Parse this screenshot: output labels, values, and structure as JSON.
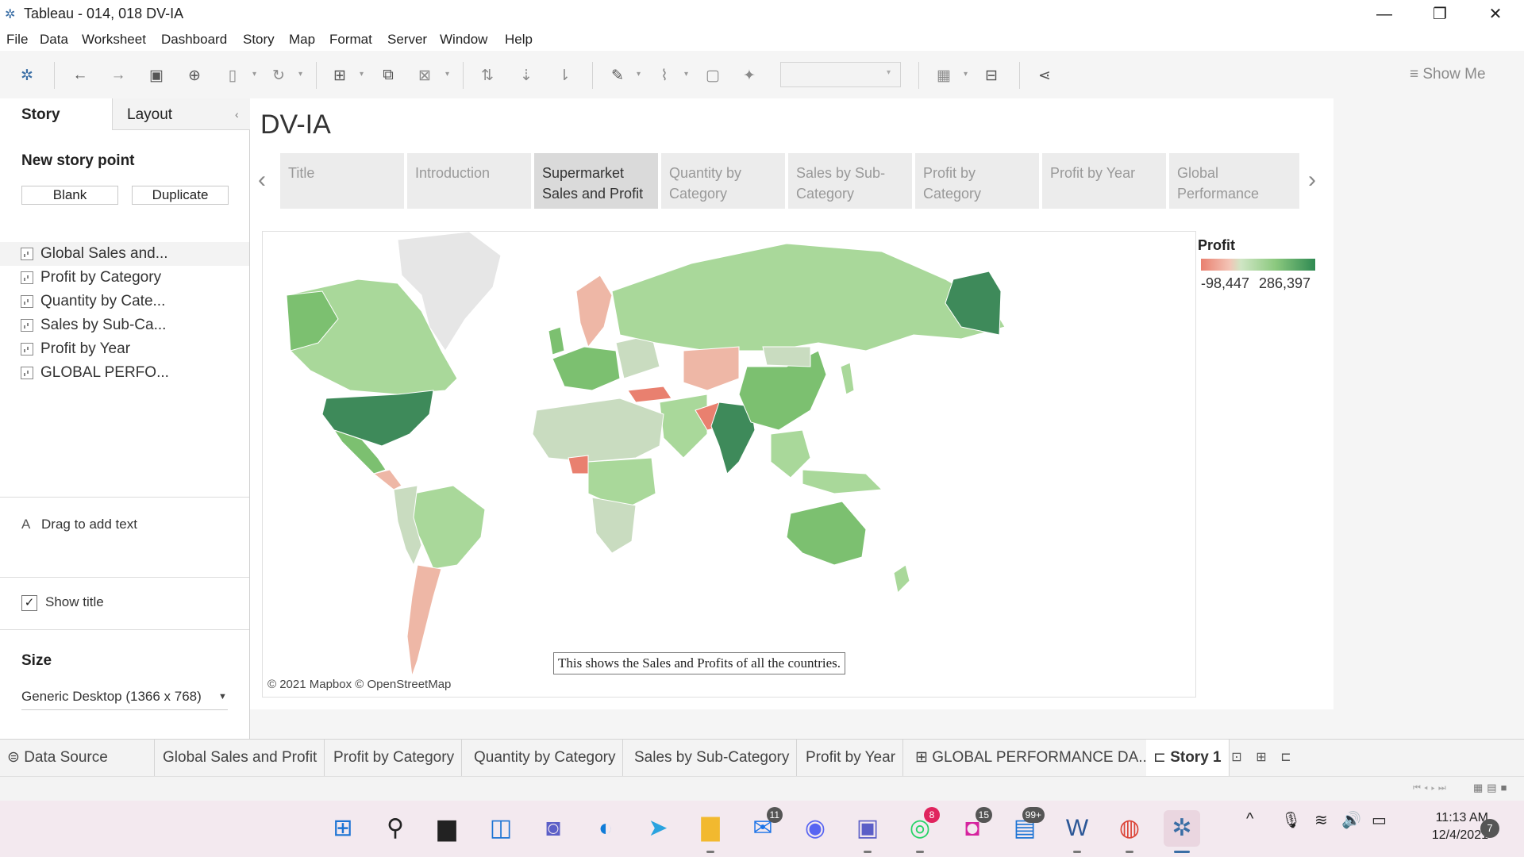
{
  "window": {
    "title": "Tableau - 014, 018 DV-IA",
    "minimize": "—",
    "restore": "❐",
    "close": "✕"
  },
  "menu": [
    "File",
    "Data",
    "Worksheet",
    "Dashboard",
    "Story",
    "Map",
    "Format",
    "Server",
    "Window",
    "Help"
  ],
  "toolbar": {
    "show_me": "Show Me",
    "icons": [
      "tableau-logo-icon",
      "undo-icon",
      "redo-icon",
      "save-icon",
      "new-data-source-icon",
      "pause-icon",
      "refresh-icon",
      "new-worksheet-icon",
      "duplicate-icon",
      "clear-icon",
      "swap-icon",
      "sort-ascending-icon",
      "sort-descending-icon",
      "highlight-icon",
      "group-icon",
      "labels-icon",
      "pin-icon",
      "fit-dropdown",
      "view-cards-icon",
      "presentation-icon",
      "share-icon"
    ]
  },
  "left_pane": {
    "tab_story": "Story",
    "tab_layout": "Layout",
    "new_story_point": "New story point",
    "btn_blank": "Blank",
    "btn_duplicate": "Duplicate",
    "sheets": [
      "Global Sales and...",
      "Profit by Category",
      "Quantity by Cate...",
      "Sales by Sub-Ca...",
      "Profit by Year",
      "GLOBAL PERFO..."
    ],
    "drag_text_icon": "A",
    "drag_text": "Drag to add text",
    "show_title_check": "✓",
    "show_title": "Show title",
    "size_heading": "Size",
    "size_value": "Generic Desktop (1366 x 768)"
  },
  "story": {
    "title": "DV-IA",
    "points": [
      {
        "line1": "Title",
        "line2": ""
      },
      {
        "line1": "Introduction",
        "line2": ""
      },
      {
        "line1": "Supermarket",
        "line2": "Sales and Profit"
      },
      {
        "line1": "Quantity by",
        "line2": "Category"
      },
      {
        "line1": "Sales by Sub-",
        "line2": "Category"
      },
      {
        "line1": "Profit by",
        "line2": "Category"
      },
      {
        "line1": "Profit by Year",
        "line2": ""
      },
      {
        "line1": "Global",
        "line2": "Performance"
      }
    ],
    "active_index": 2
  },
  "map": {
    "attribution": "© 2021 Mapbox © OpenStreetMap",
    "caption": "This shows the Sales and Profits of all the countries.",
    "legend_title": "Profit",
    "legend_min": "-98,447",
    "legend_max": "286,397",
    "colors": {
      "strong_positive": "#3e8a5a",
      "positive": "#7cc070",
      "light_positive": "#a9d89a",
      "neutral": "#c9dcc0",
      "negative": "#e9806f",
      "light_negative": "#eeb7a6",
      "no_data": "#e6e6e6"
    }
  },
  "sheet_tabs": [
    "Data Source",
    "Global Sales and Profit",
    "Profit by Category",
    "Quantity by Category",
    "Sales by Sub-Category",
    "Profit by Year",
    "GLOBAL PERFORMANCE DA...",
    "Story 1"
  ],
  "taskbar": {
    "badges": {
      "mail": "11",
      "whatsapp": "8",
      "instagram": "15",
      "file": "99+"
    },
    "time": "11:13 AM",
    "date": "12/4/2021",
    "notifications": "7"
  }
}
